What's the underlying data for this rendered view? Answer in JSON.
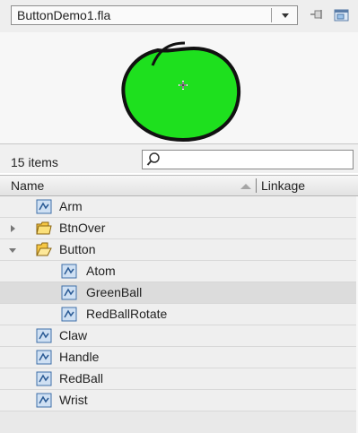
{
  "header": {
    "document": "ButtonDemo1.fla"
  },
  "toolbar": {
    "pin_icon": "pin-icon",
    "new_library_icon": "new-library-panel-icon"
  },
  "preview": {
    "fill_color": "#1ee01e",
    "stroke_color": "#111111"
  },
  "search": {
    "count_label": "15 items",
    "placeholder": ""
  },
  "columns": {
    "name": "Name",
    "linkage": "Linkage"
  },
  "items": [
    {
      "label": "Arm",
      "type": "movieclip",
      "depth": 0
    },
    {
      "label": "BtnOver",
      "type": "folder",
      "depth": 0,
      "expanded": false
    },
    {
      "label": "Button",
      "type": "folder",
      "depth": 0,
      "expanded": true
    },
    {
      "label": "Atom",
      "type": "movieclip",
      "depth": 1
    },
    {
      "label": "GreenBall",
      "type": "movieclip",
      "depth": 1,
      "selected": true
    },
    {
      "label": "RedBallRotate",
      "type": "movieclip",
      "depth": 1
    },
    {
      "label": "Claw",
      "type": "movieclip",
      "depth": 0
    },
    {
      "label": "Handle",
      "type": "movieclip",
      "depth": 0
    },
    {
      "label": "RedBall",
      "type": "movieclip",
      "depth": 0
    },
    {
      "label": "Wrist",
      "type": "movieclip",
      "depth": 0
    }
  ]
}
